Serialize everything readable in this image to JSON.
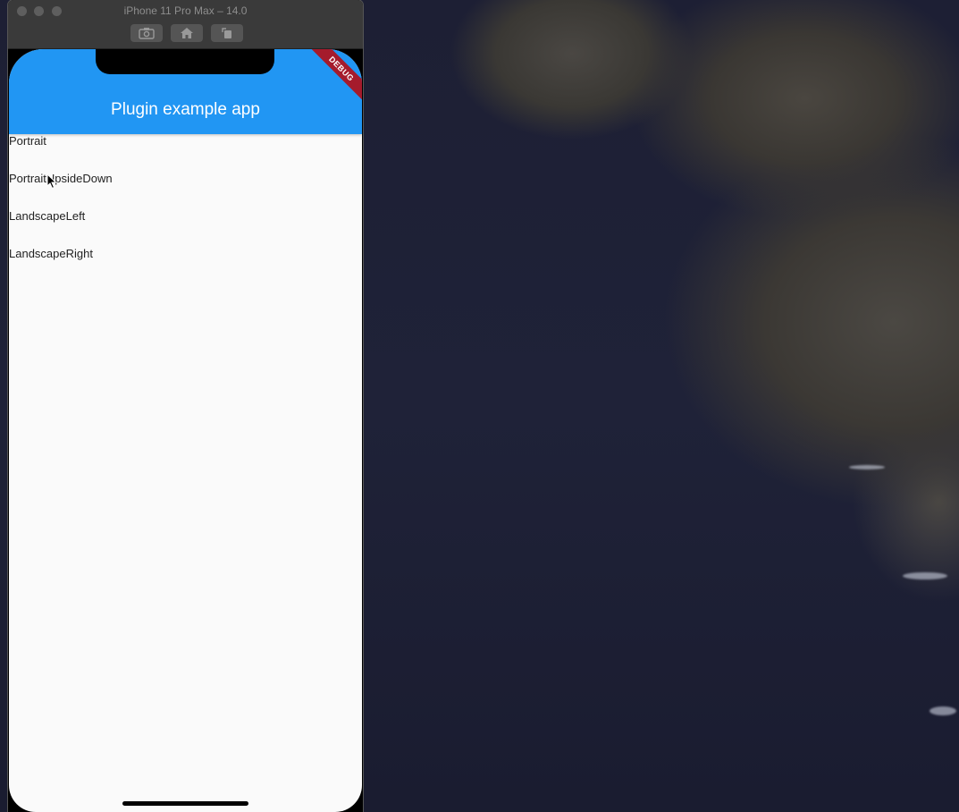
{
  "window": {
    "title": "iPhone 11 Pro Max – 14.0"
  },
  "toolbar": {
    "buttons": [
      {
        "name": "screenshot-icon"
      },
      {
        "name": "home-icon"
      },
      {
        "name": "rotate-icon"
      }
    ]
  },
  "app": {
    "title": "Plugin example app",
    "debug_banner": "DEBUG",
    "items": [
      {
        "label": "Portrait"
      },
      {
        "label": "PortraitUpsideDown"
      },
      {
        "label": "LandscapeLeft"
      },
      {
        "label": "LandscapeRight"
      }
    ]
  },
  "colors": {
    "app_bar": "#2196f3",
    "debug_banner": "#a51b2c",
    "screen_background": "#fafafa"
  }
}
